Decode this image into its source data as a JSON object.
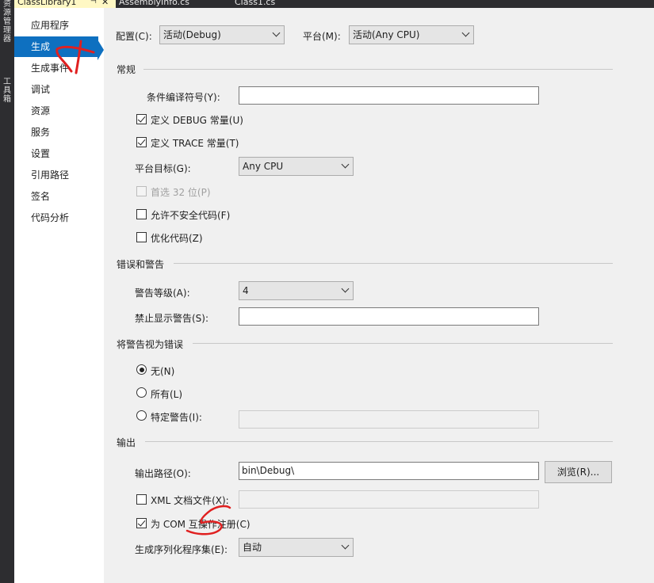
{
  "side_tabs": [
    "资源管理器",
    "工具箱"
  ],
  "doc_tabs": [
    {
      "label": "ClassLibrary1",
      "pin": "⊣",
      "close": "✕"
    },
    {
      "label": "AssemblyInfo.cs"
    },
    {
      "label": "Class1.cs"
    }
  ],
  "nav": {
    "items": [
      "应用程序",
      "生成",
      "生成事件",
      "调试",
      "资源",
      "服务",
      "设置",
      "引用路径",
      "签名",
      "代码分析"
    ],
    "active_index": 1
  },
  "top": {
    "config_label": "配置(C):",
    "config_value": "活动(Debug)",
    "platform_label": "平台(M):",
    "platform_value": "活动(Any CPU)"
  },
  "general": {
    "title": "常规",
    "cond_symbols_label": "条件编译符号(Y):",
    "cond_symbols_value": "",
    "define_debug": {
      "label": "定义 DEBUG 常量(U)",
      "checked": true
    },
    "define_trace": {
      "label": "定义 TRACE 常量(T)",
      "checked": true
    },
    "platform_target_label": "平台目标(G):",
    "platform_target_value": "Any CPU",
    "prefer32": {
      "label": "首选 32 位(P)",
      "checked": false,
      "enabled": false
    },
    "unsafe": {
      "label": "允许不安全代码(F)",
      "checked": false
    },
    "optimize": {
      "label": "优化代码(Z)",
      "checked": false
    }
  },
  "errors": {
    "title": "错误和警告",
    "warning_level_label": "警告等级(A):",
    "warning_level_value": "4",
    "suppress_label": "禁止显示警告(S):",
    "suppress_value": ""
  },
  "treat": {
    "title": "将警告视为错误",
    "none_label": "无(N)",
    "all_label": "所有(L)",
    "specific_label": "特定警告(I):",
    "selected": "none"
  },
  "output": {
    "title": "输出",
    "path_label": "输出路径(O):",
    "path_value": "bin\\Debug\\",
    "browse_label": "浏览(R)...",
    "xml_doc": {
      "label": "XML 文档文件(X):",
      "checked": false
    },
    "com_interop": {
      "label": "为 COM 互操作注册(C)",
      "checked": true
    },
    "serialization_label": "生成序列化程序集(E):",
    "serialization_value": "自动"
  },
  "colors": {
    "accent": "#0e70c0",
    "annotation": "#e02020",
    "active_tab": "#fff8c4",
    "dark_chrome": "#2d2d30"
  }
}
